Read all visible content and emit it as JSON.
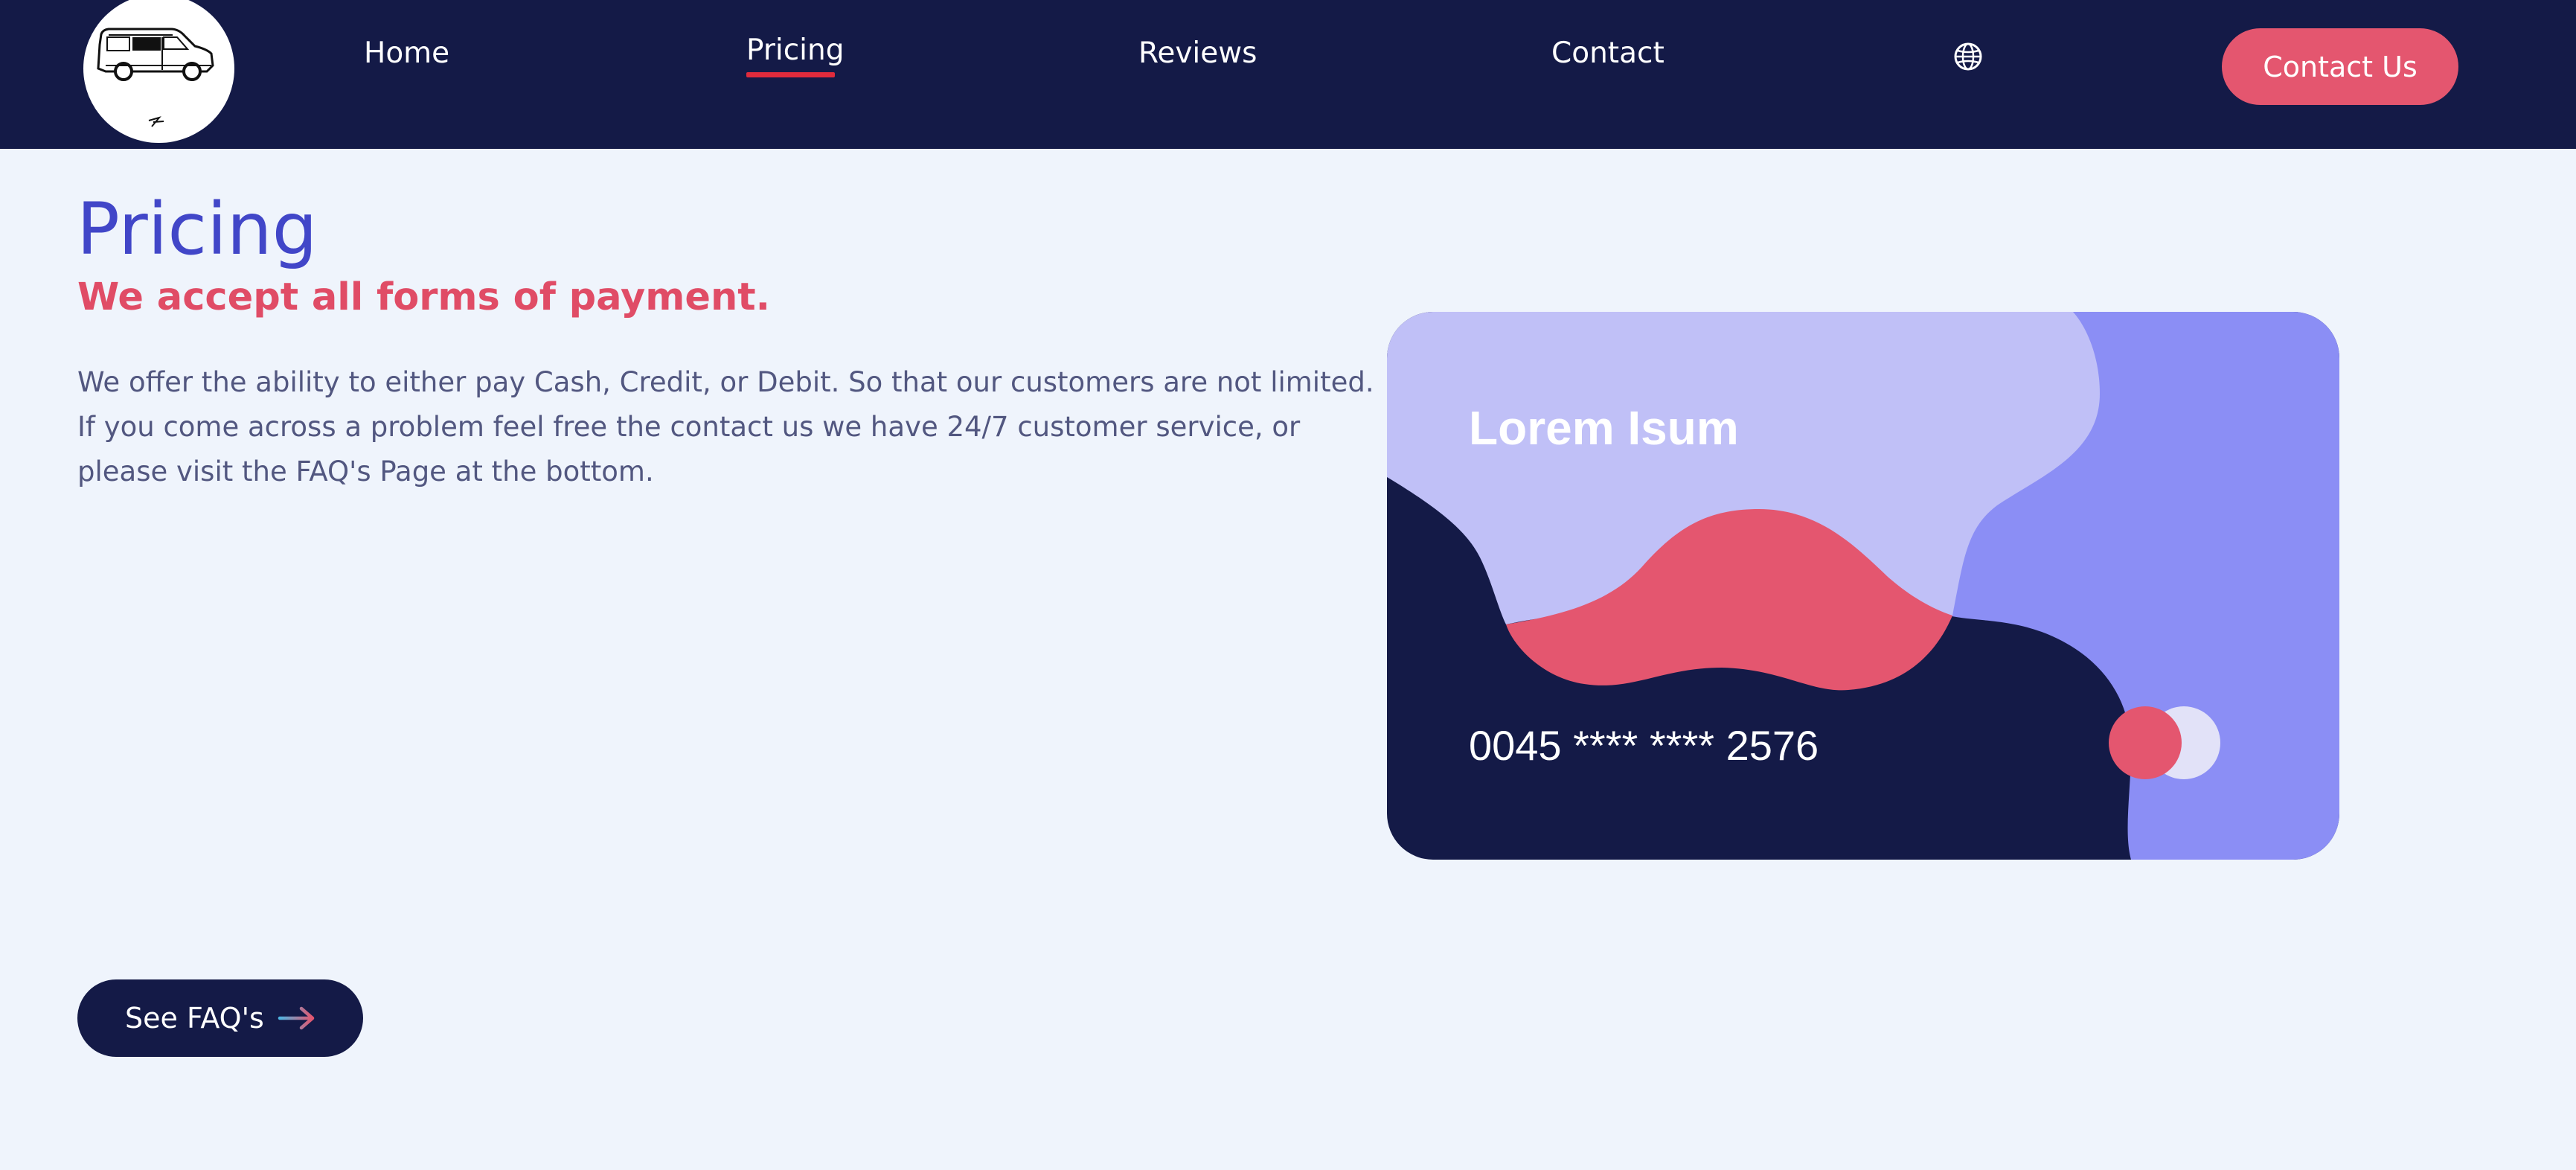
{
  "colors": {
    "nav_bg": "#141a47",
    "page_bg": "#eff4fc",
    "accent_red": "#e4566f",
    "accent_blue": "#4146c8",
    "card_lavender": "#c0c0f7",
    "card_periwinkle": "#8b8ef5",
    "active_underline": "#e02b3c"
  },
  "nav": {
    "logo_icon": "van-logo-icon",
    "links": [
      {
        "label": "Home",
        "active": false
      },
      {
        "label": "Pricing",
        "active": true
      },
      {
        "label": "Reviews",
        "active": false
      },
      {
        "label": "Contact",
        "active": false
      }
    ],
    "language_icon": "globe-icon",
    "cta_label": "Contact Us"
  },
  "main": {
    "title": "Pricing",
    "subtitle": "We accept all forms of payment.",
    "body_lines": [
      "We offer the ability to either pay Cash, Credit, or Debit. So that our customers are not limited.",
      "If you come across a problem feel free the contact us we have 24/7 customer service, or",
      "please visit the FAQ's Page at the bottom."
    ],
    "faq_button": {
      "label": "See FAQ's",
      "icon": "arrow-right-icon"
    }
  },
  "card": {
    "title": "Lorem Isum",
    "number": "0045 **** **** 2576",
    "brand_icon": "card-brand-circles-icon"
  }
}
